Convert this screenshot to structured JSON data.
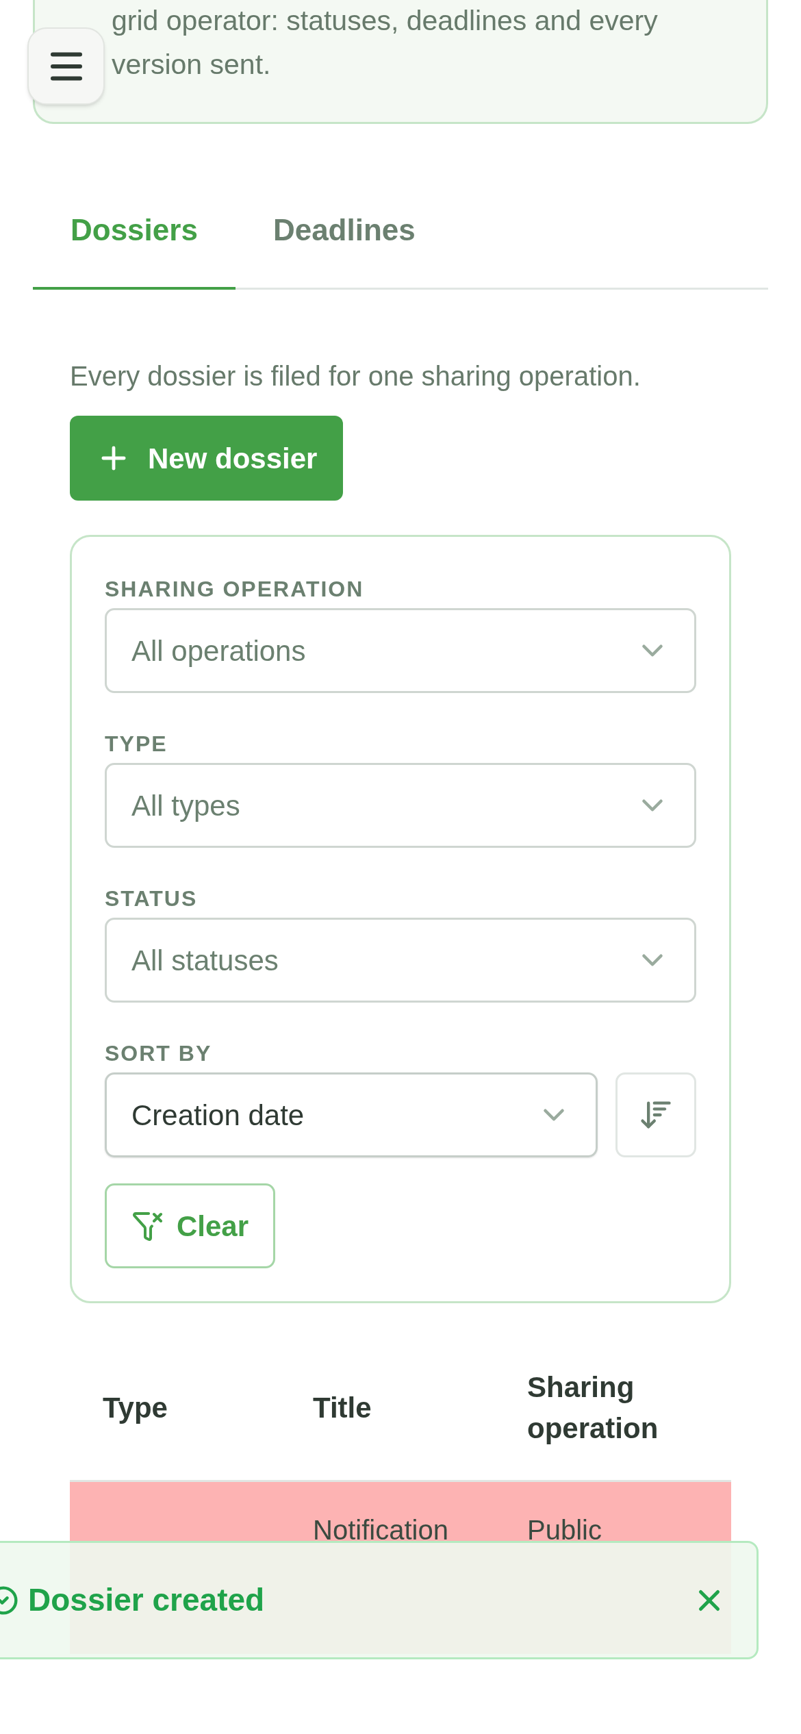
{
  "intro": {
    "text": "grid operator: statuses, deadlines and every version sent."
  },
  "tabs": [
    {
      "label": "Dossiers",
      "selected": true
    },
    {
      "label": "Deadlines",
      "selected": false
    }
  ],
  "description": "Every dossier is filed for one sharing operation.",
  "new_button": {
    "label": "New dossier"
  },
  "filters": [
    {
      "label": "SHARING OPERATION",
      "value": "All operations"
    },
    {
      "label": "TYPE",
      "value": "All types"
    },
    {
      "label": "STATUS",
      "value": "All statuses"
    }
  ],
  "sort": {
    "label": "SORT BY",
    "value": "Creation date"
  },
  "clear_button": {
    "label": "Clear"
  },
  "table": {
    "columns": [
      "Type",
      "Title",
      "Sharing operation"
    ],
    "rows": [
      {
        "title": "Notification",
        "sharing_operation": "Public",
        "color": "#fdb3b3"
      }
    ]
  },
  "toast": {
    "message": "Dossier created"
  }
}
